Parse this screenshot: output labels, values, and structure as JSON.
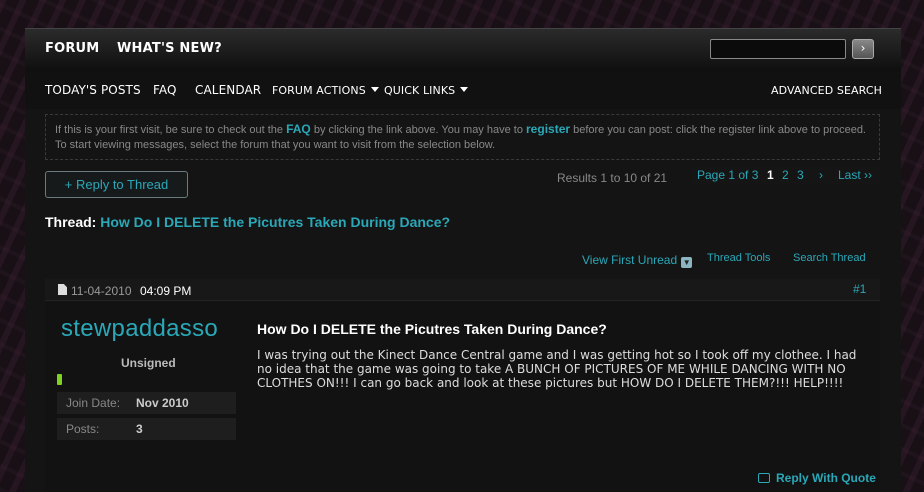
{
  "navbar": {
    "tabs": [
      {
        "label": "FORUM"
      },
      {
        "label": "WHAT'S NEW?"
      }
    ],
    "search_button": "›"
  },
  "subnav": {
    "links": [
      {
        "label": "TODAY'S POSTS"
      },
      {
        "label": "FAQ"
      },
      {
        "label": "CALENDAR"
      },
      {
        "label": "FORUM ACTIONS"
      },
      {
        "label": "QUICK LINKS"
      }
    ],
    "advanced_search": "ADVANCED SEARCH"
  },
  "notice": {
    "part1": "If this is your first visit, be sure to check out the ",
    "faq_link": "FAQ",
    "part2": " by clicking the link above. You may have to ",
    "register_link": "register",
    "part3": " before you can post: click the register link above to proceed. To start viewing messages, select the forum that you want to visit from the selection below."
  },
  "reply_button": "+ Reply to Thread",
  "results": "Results 1 to 10 of 21",
  "pagination": {
    "page_of": "Page 1 of 3",
    "pages": [
      "1",
      "2",
      "3"
    ],
    "next": "›",
    "last": "Last ››"
  },
  "thread": {
    "prefix": "Thread:",
    "title": "How Do I DELETE the Picutres Taken During Dance?"
  },
  "thread_tools": {
    "view_first_unread": "View First Unread",
    "thread_tools": "Thread Tools",
    "search_thread": "Search Thread"
  },
  "post": {
    "date": "11-04-2010",
    "time": "04:09 PM",
    "number": "#1",
    "username": "stewpaddasso",
    "usertitle": "Unsigned",
    "stats": [
      {
        "key": "Join Date:",
        "value": "Nov 2010"
      },
      {
        "key": "Posts:",
        "value": "3"
      }
    ],
    "title": "How Do I DELETE the Picutres Taken During Dance?",
    "body": "I was trying out the Kinect Dance Central game and I was getting hot so I took off my clothee. I had no idea that the game was going to take A BUNCH OF PICTURES OF ME WHILE DANCING WITH NO CLOTHES ON!!! I can go back and look at these pictures but HOW DO I DELETE THEM?!!! HELP!!!!",
    "reply_with_quote": "Reply With Quote"
  }
}
